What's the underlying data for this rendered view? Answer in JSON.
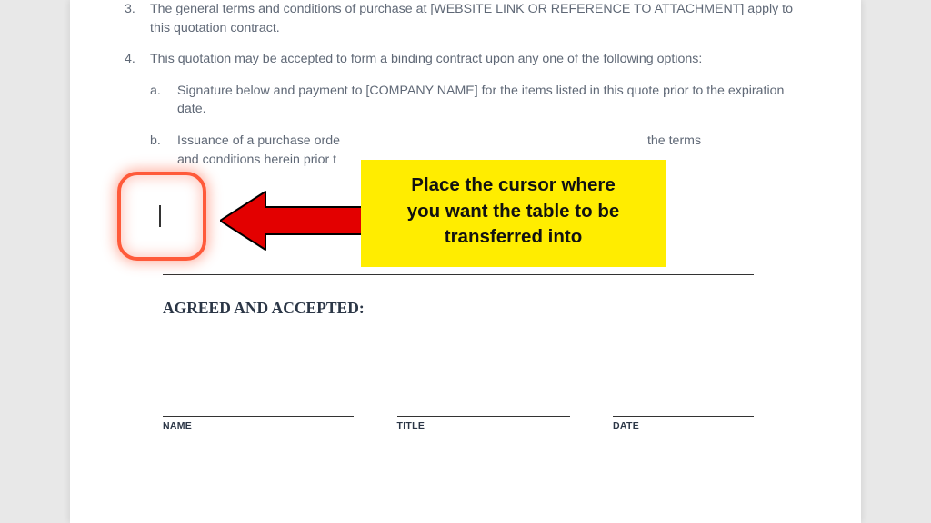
{
  "list": {
    "item3": "The general terms and conditions of purchase at [WEBSITE LINK OR REFERENCE TO ATTACHMENT] apply to this quotation contract.",
    "item4": "This quotation may be accepted to form a binding contract upon any one of the following options:",
    "sub_a": "Signature below and payment to [COMPANY NAME] for the items listed in this quote prior to the expiration date.",
    "sub_b_left": "Issuance of a purchase orde",
    "sub_b_right": "the terms",
    "sub_b_line2": "and conditions herein prior t"
  },
  "callout": {
    "line1": "Place the cursor where",
    "line2": "you want the table to be",
    "line3": "transferred into"
  },
  "agreed_heading": "AGREED AND ACCEPTED:",
  "signature": {
    "name": "NAME",
    "title": "TITLE",
    "date": "DATE"
  }
}
